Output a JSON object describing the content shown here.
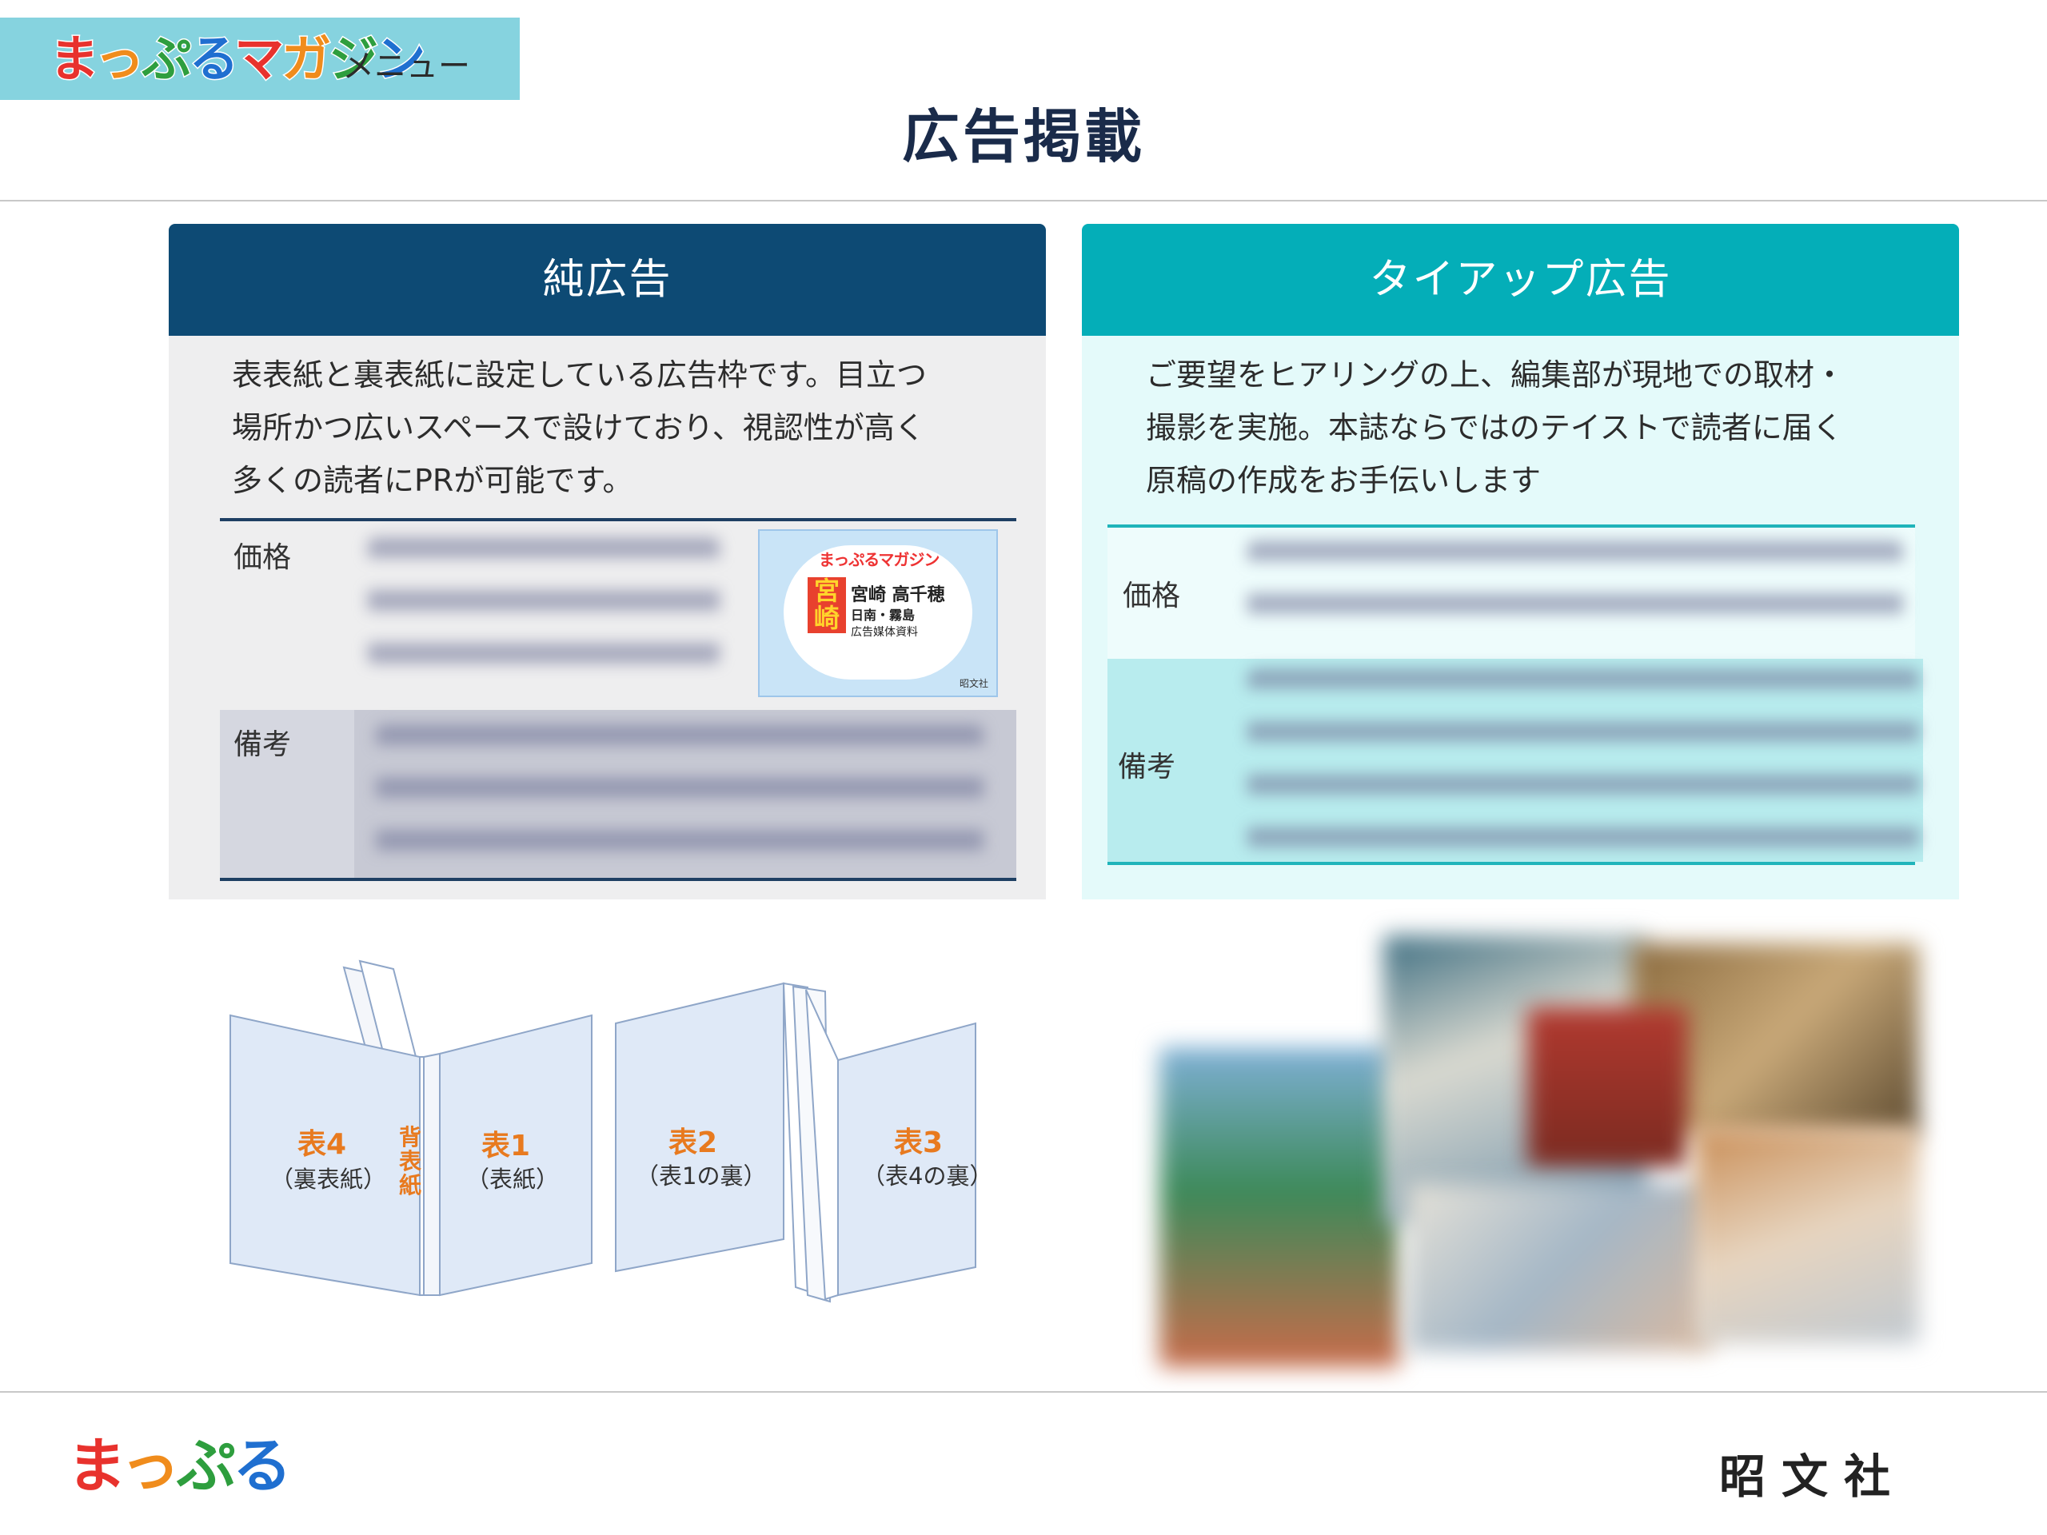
{
  "header": {
    "logo_text": [
      "ま",
      "っ",
      "ぷ",
      "る",
      "マ",
      "ガ",
      "ジ",
      "ン"
    ],
    "logo_colors": [
      "#e8322d",
      "#f08c1c",
      "#2e9e3e",
      "#1f6fd0",
      "#e8322d",
      "#f08c1c",
      "#2e9e3e",
      "#1f6fd0"
    ],
    "menu_label": "メニュー",
    "title": "広告掲載"
  },
  "left_panel": {
    "heading": "純広告",
    "description": [
      "表表紙と裏表紙に設定している広告枠です。目立つ",
      "場所かつ広いスペースで設けており、視認性が高く",
      "多くの読者にPRが可能です。"
    ],
    "price_label": "価格",
    "notes_label": "備考",
    "thumbnail": {
      "logo": "まっぷるマガジン",
      "city": "宮崎",
      "line1": "宮崎 高千穂",
      "line2": "日南・霧島",
      "line3": "広告媒体資料",
      "publisher": "昭文社"
    }
  },
  "right_panel": {
    "heading": "タイアップ広告",
    "description": [
      "ご要望をヒアリングの上、編集部が現地での取材・",
      "撮影を実施。本誌ならではのテイストで読者に届く",
      "原稿の作成をお手伝いします"
    ],
    "price_label": "価格",
    "notes_label": "備考"
  },
  "book_diagram": {
    "cover4": {
      "label": "表4",
      "sub": "（裏表紙）"
    },
    "spine": [
      "背",
      "表",
      "紙"
    ],
    "cover1": {
      "label": "表1",
      "sub": "（表紙）"
    },
    "cover2": {
      "label": "表2",
      "sub": "（表1の裏）"
    },
    "cover3": {
      "label": "表3",
      "sub": "（表4の裏）"
    }
  },
  "footer": {
    "logo_text": [
      "ま",
      "っ",
      "ぷ",
      "る"
    ],
    "logo_colors": [
      "#e8322d",
      "#f08c1c",
      "#2e9e3e",
      "#1f6fd0"
    ],
    "publisher": "昭文社"
  },
  "colors": {
    "left_heading_bg": "#0d4a74",
    "right_heading_bg": "#04aeb8",
    "accent_orange": "#e87a1f"
  }
}
